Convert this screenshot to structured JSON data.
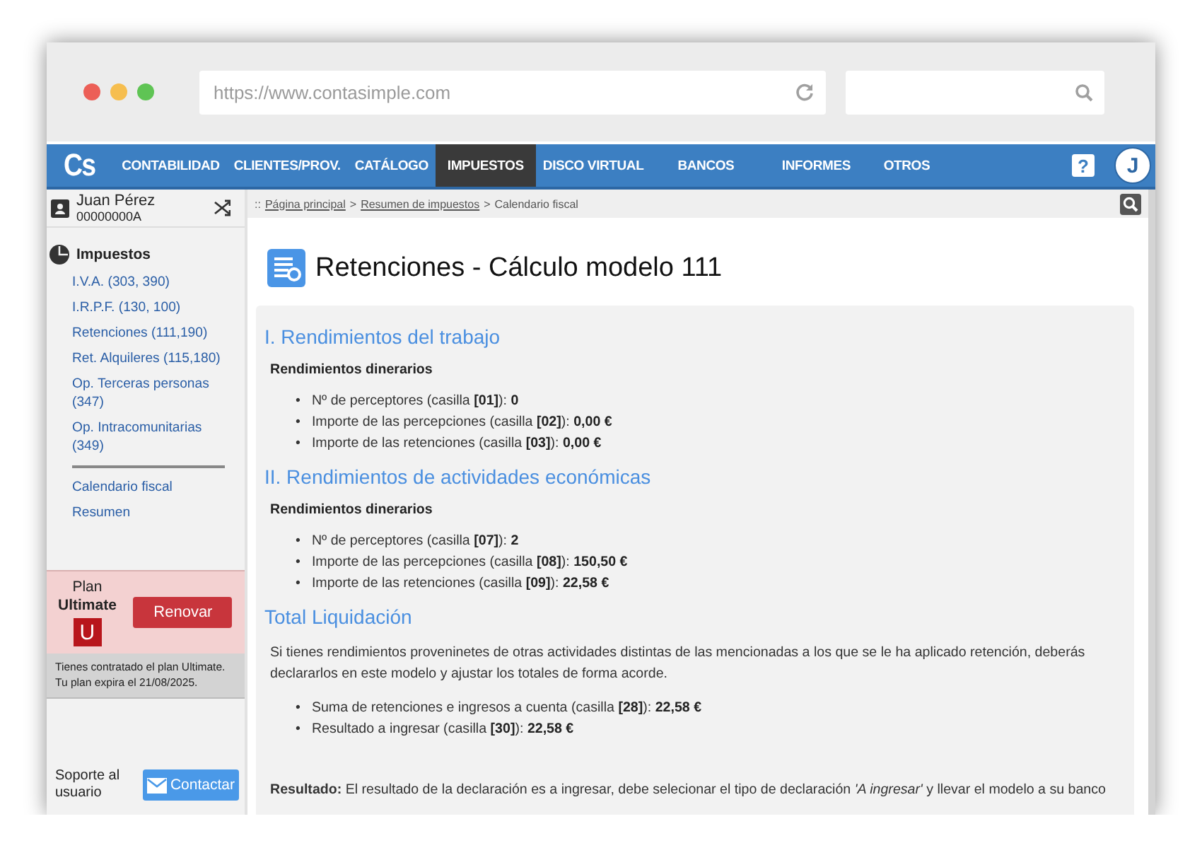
{
  "browser": {
    "url": "https://www.contasimple.com"
  },
  "nav": {
    "logo": "Cs",
    "items": [
      {
        "label": "CONTABILIDAD",
        "selected": false
      },
      {
        "label": "CLIENTES/PROV.",
        "selected": false
      },
      {
        "label": "CATÁLOGO",
        "selected": false
      },
      {
        "label": "IMPUESTOS",
        "selected": true
      },
      {
        "label": "DISCO VIRTUAL",
        "selected": false
      },
      {
        "label": "BANCOS",
        "selected": false
      },
      {
        "label": "INFORMES",
        "selected": false
      },
      {
        "label": "OTROS",
        "selected": false
      }
    ],
    "help": "?",
    "avatar": "J"
  },
  "sidebar": {
    "user": {
      "name": "Juan Pérez",
      "id": "00000000A"
    },
    "section": "Impuestos",
    "links": [
      "I.V.A. (303, 390)",
      "I.R.P.F. (130, 100)",
      "Retenciones (111,190)",
      "Ret. Alquileres (115,180)",
      "Op. Terceras personas (347)",
      "Op. Intracomunitarias (349)"
    ],
    "extra_links": [
      "Calendario fiscal",
      "Resumen"
    ],
    "plan": {
      "label": "Plan",
      "name": "Ultimate",
      "badge": "U",
      "button": "Renovar",
      "note": "Tienes contratado el plan Ultimate. Tu plan expira el 21/08/2025."
    },
    "support": {
      "label": "Soporte al usuario",
      "button": "Contactar"
    }
  },
  "breadcrumb": [
    {
      "kind": "text",
      "text": "::"
    },
    {
      "kind": "link",
      "text": "Página principal"
    },
    {
      "kind": "text",
      "text": ">"
    },
    {
      "kind": "link",
      "text": "Resumen de impuestos"
    },
    {
      "kind": "text",
      "text": ">"
    },
    {
      "kind": "text",
      "text": "Calendario fiscal"
    }
  ],
  "content": {
    "title": "Retenciones - Cálculo modelo 111",
    "blocks": [
      {
        "kind": "heading",
        "text": "I. Rendimientos del trabajo"
      },
      {
        "kind": "subheading",
        "text": "Rendimientos dinerarios"
      },
      {
        "kind": "list",
        "items": [
          {
            "bullet": "•",
            "text": "Nº de perceptores (casilla **[01]**): **0**"
          },
          {
            "bullet": "•",
            "text": "Importe de las percepciones (casilla **[02]**): **0,00 €**"
          },
          {
            "bullet": "•",
            "text": "Importe de las retenciones (casilla **[03]**): **0,00 €**"
          }
        ]
      },
      {
        "kind": "heading",
        "text": "II. Rendimientos de actividades económicas"
      },
      {
        "kind": "subheading",
        "text": "Rendimientos dinerarios"
      },
      {
        "kind": "list",
        "items": [
          {
            "bullet": "•",
            "text": "Nº de perceptores (casilla **[07]**): **2**"
          },
          {
            "bullet": "•",
            "text": "Importe de las percepciones (casilla **[08]**): **150,50 €**"
          },
          {
            "bullet": "•",
            "text": "Importe de las retenciones (casilla **[09]**): **22,58 €**"
          }
        ]
      },
      {
        "kind": "heading",
        "text": "Total Liquidación"
      },
      {
        "kind": "paragraph",
        "text": "Si tienes rendimientos proveninetes de otras actividades distintas de las mencionadas a los que se le ha aplicado retención, deberás declararlos en este modelo y ajustar los totales de forma acorde."
      },
      {
        "kind": "list",
        "items": [
          {
            "bullet": "•",
            "text": "Suma de retenciones e ingresos a cuenta (casilla **[28]**): **22,58 €**"
          },
          {
            "bullet": "•",
            "text": "Resultado a ingresar (casilla **[30]**): **22,58 €**"
          }
        ]
      },
      {
        "kind": "result",
        "text": "**Resultado:** El resultado de la declaración es a ingresar, debe selecionar el tipo de declaración *'A ingresar'* y llevar el modelo a su banco"
      }
    ]
  }
}
